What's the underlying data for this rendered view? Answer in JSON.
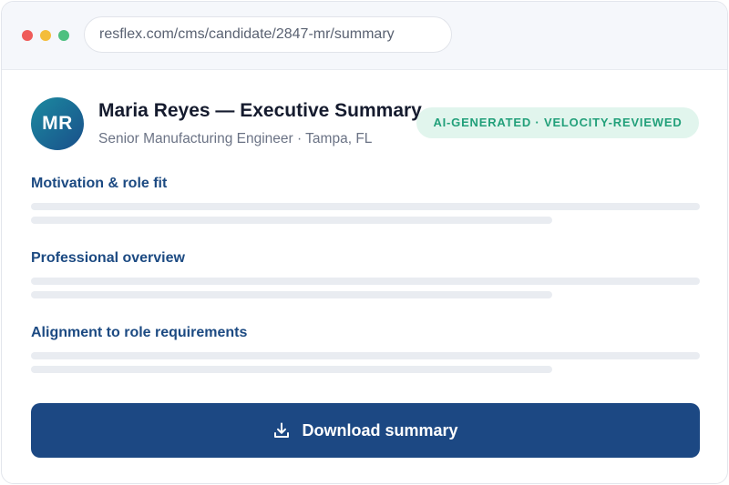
{
  "browser": {
    "url": "resflex.com/cms/candidate/2847-mr/summary"
  },
  "candidate": {
    "initials": "MR",
    "name_heading": "Maria Reyes — Executive Summary",
    "subtitle": "Senior Manufacturing Engineer · Tampa, FL",
    "badge": "AI-GENERATED · VELOCITY-REVIEWED"
  },
  "sections": [
    {
      "title": "Motivation & role fit"
    },
    {
      "title": "Professional overview"
    },
    {
      "title": "Alignment to role requirements"
    }
  ],
  "actions": {
    "download_label": "Download summary"
  },
  "icons": {
    "download": "download-icon"
  },
  "colors": {
    "primary": "#1c4883",
    "accent_teal": "#22a07a",
    "badge_bg": "#e1f5ed",
    "section_heading": "#1c4a82"
  }
}
